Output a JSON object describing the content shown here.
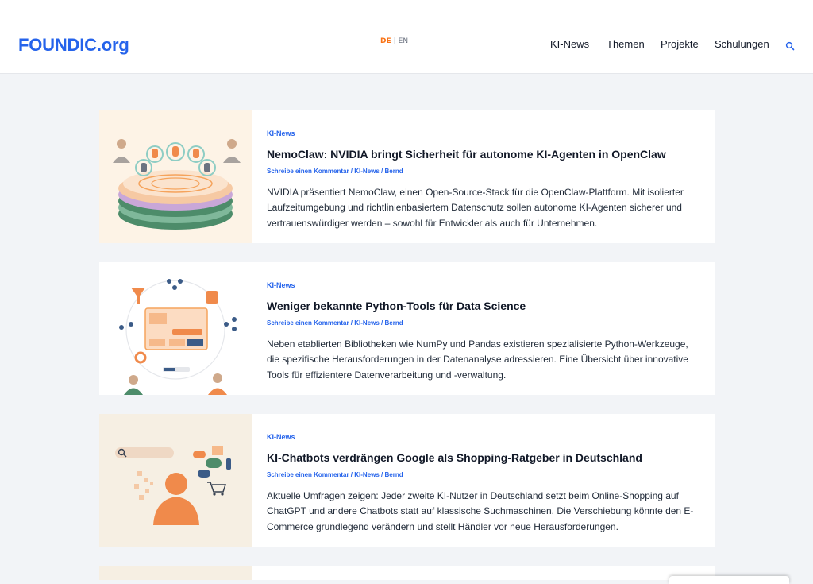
{
  "header": {
    "logo": "FOUNDIC.org",
    "lang": {
      "active": "DE",
      "separator": "|",
      "other": "EN"
    },
    "nav": [
      "KI-News",
      "Themen",
      "Projekte",
      "Schulungen"
    ],
    "search_icon": "search-icon"
  },
  "articles": [
    {
      "category": "KI-News",
      "title": "NemoClaw: NVIDIA bringt Sicherheit für autonome KI-Agenten in OpenClaw",
      "meta": "Schreibe einen Kommentar / KI-News / Bernd",
      "excerpt": "NVIDIA präsentiert NemoClaw, einen Open-Source-Stack für die OpenClaw-Plattform. Mit isolierter Laufzeitumgebung und richtlinienbasiertem Datenschutz sollen autonome KI-Agenten sicherer und vertrauenswürdiger werden – sowohl für Entwickler als auch für Unternehmen."
    },
    {
      "category": "KI-News",
      "title": "Weniger bekannte Python-Tools für Data Science",
      "meta": "Schreibe einen Kommentar / KI-News / Bernd",
      "excerpt": "Neben etablierten Bibliotheken wie NumPy und Pandas existieren spezialisierte Python-Werkzeuge, die spezifische Herausforderungen in der Datenanalyse adressieren. Eine Übersicht über innovative Tools für effizientere Datenverarbeitung und -verwaltung."
    },
    {
      "category": "KI-News",
      "title": "KI-Chatbots verdrängen Google als Shopping-Ratgeber in Deutschland",
      "meta": "Schreibe einen Kommentar / KI-News / Bernd",
      "excerpt": "Aktuelle Umfragen zeigen: Jeder zweite KI-Nutzer in Deutschland setzt beim Online-Shopping auf ChatGPT und andere Chatbots statt auf klassische Suchmaschinen. Die Verschiebung könnte den E-Commerce grundlegend verändern und stellt Händler vor neue Herausforderungen."
    }
  ],
  "colors": {
    "brand": "#2563eb",
    "accent": "#f97316",
    "background": "#f2f4f7"
  }
}
